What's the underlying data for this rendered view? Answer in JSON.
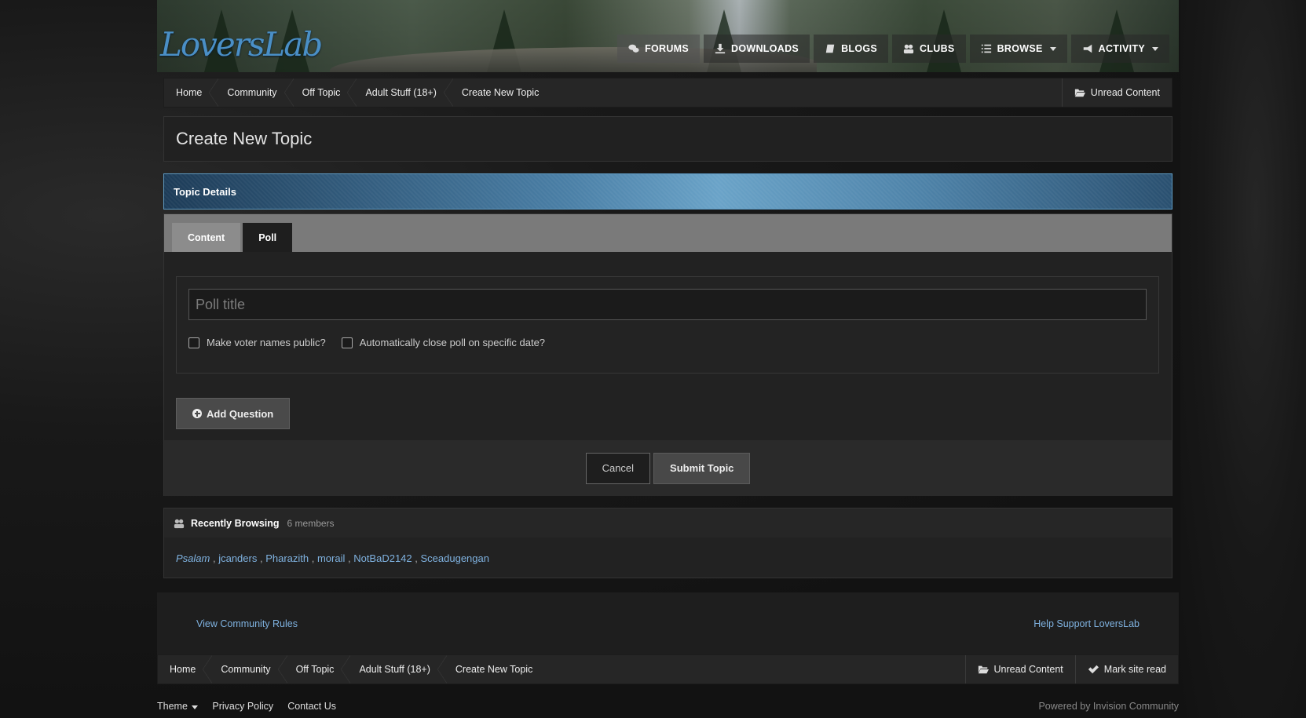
{
  "header": {
    "logo_text": "LoversLab",
    "nav": [
      {
        "label": "FORUMS"
      },
      {
        "label": "DOWNLOADS"
      },
      {
        "label": "BLOGS"
      },
      {
        "label": "CLUBS"
      },
      {
        "label": "BROWSE"
      },
      {
        "label": "ACTIVITY"
      }
    ]
  },
  "breadcrumb": {
    "items": [
      "Home",
      "Community",
      "Off Topic",
      "Adult Stuff (18+)",
      "Create New Topic"
    ],
    "unread_label": "Unread Content",
    "mark_read_label": "Mark site read"
  },
  "page": {
    "title": "Create New Topic",
    "section_title": "Topic Details",
    "tabs": [
      {
        "label": "Content"
      },
      {
        "label": "Poll"
      }
    ],
    "poll": {
      "title_placeholder": "Poll title",
      "title_value": "",
      "option_public": "Make voter names public?",
      "option_close": "Automatically close poll on specific date?"
    },
    "add_question_label": "Add Question",
    "cancel_label": "Cancel",
    "submit_label": "Submit Topic"
  },
  "recently_browsing": {
    "title": "Recently Browsing",
    "count": "6 members",
    "members": [
      "Psalam",
      "jcanders",
      "Pharazith",
      "morail",
      "NotBaD2142",
      "Sceadugengan"
    ],
    "separator": " , "
  },
  "footer": {
    "rules_link": "View Community Rules",
    "support_link": "Help Support LoversLab",
    "theme_label": "Theme",
    "privacy_label": "Privacy Policy",
    "contact_label": "Contact Us",
    "powered_by": "Powered by Invision Community"
  }
}
